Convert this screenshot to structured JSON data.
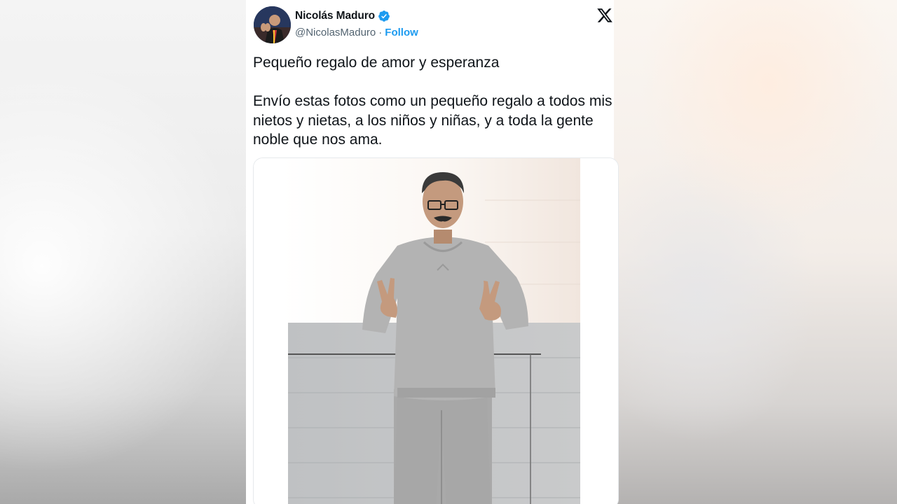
{
  "author": {
    "name": "Nicolás Maduro",
    "handle": "@NicolasMaduro",
    "separator": "·",
    "follow_label": "Follow",
    "verified": true
  },
  "tweet": {
    "title": "Pequeño regalo de amor y esperanza",
    "body": "Envío estas fotos como un pequeño regalo a todos mis nietos y nietas, a los niños y niñas, y a toda la gente noble que nos ama."
  },
  "icons": {
    "platform": "x-logo-icon",
    "badge": "verified-badge-icon"
  },
  "colors": {
    "link": "#1d9bf0",
    "text": "#0f1419",
    "secondary": "#536471"
  }
}
